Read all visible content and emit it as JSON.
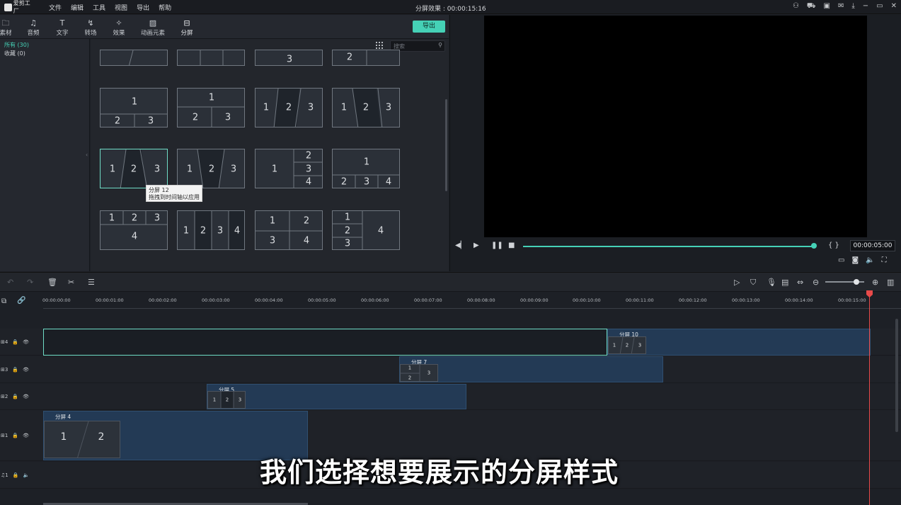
{
  "app": {
    "logo_text": "爱剪工厂",
    "menu": [
      "文件",
      "编辑",
      "工具",
      "视图",
      "导出",
      "帮助"
    ],
    "window_title": "分屏效果 : 00:00:15:16"
  },
  "tool_tabs": [
    {
      "label": "素材",
      "icon": "folder-icon"
    },
    {
      "label": "音频",
      "icon": "music-note-icon"
    },
    {
      "label": "文字",
      "icon": "text-icon"
    },
    {
      "label": "转场",
      "icon": "transition-icon"
    },
    {
      "label": "效果",
      "icon": "effects-icon"
    },
    {
      "label": "动画元素",
      "icon": "image-icon"
    },
    {
      "label": "分屏",
      "icon": "split-screen-icon"
    }
  ],
  "export_label": "导出",
  "categories": {
    "all": "所有 (30)",
    "favorites": "收藏 (0)"
  },
  "search": {
    "placeholder": "搜索"
  },
  "tiles": {
    "top_partial_numbers": [
      "3",
      "2"
    ],
    "row1": [
      [
        "1",
        "2",
        "3"
      ],
      [
        "1",
        "2",
        "3"
      ],
      [
        "1",
        "2",
        "3"
      ],
      [
        "1",
        "2",
        "3"
      ]
    ],
    "row2": [
      [
        "1",
        "2",
        "3"
      ],
      [
        "1",
        "2",
        "3"
      ],
      [
        "1",
        "2",
        "3",
        "4"
      ],
      [
        "1",
        "2",
        "3",
        "4"
      ]
    ],
    "row3": [
      [
        "1",
        "2",
        "3",
        "4"
      ],
      [
        "1",
        "2",
        "3",
        "4"
      ],
      [
        "1",
        "2",
        "3",
        "4"
      ],
      [
        "1",
        "2",
        "3",
        "4"
      ]
    ]
  },
  "tooltip": {
    "title": "分屏 12",
    "hint": "拖拽到时间轴以应用"
  },
  "preview": {
    "timecode": "00:00:05:00",
    "brackets": "{ }",
    "progress": 0.93
  },
  "ruler_ticks": [
    "00:00:00:00",
    "00:00:01:00",
    "00:00:02:00",
    "00:00:03:00",
    "00:00:04:00",
    "00:00:05:00",
    "00:00:06:00",
    "00:00:07:00",
    "00:00:08:00",
    "00:00:09:00",
    "00:00:10:00",
    "00:00:11:00",
    "00:00:12:00",
    "00:00:13:00",
    "00:00:14:00",
    "00:00:15:00"
  ],
  "tracks": [
    {
      "id": "4",
      "clip_name": "分屏 10",
      "thumb_numbers": [
        "1",
        "2",
        "3"
      ]
    },
    {
      "id": "3",
      "clip_name": "分屏 7",
      "thumb_numbers": [
        "1",
        "3",
        "2"
      ]
    },
    {
      "id": "2",
      "clip_name": "分屏 5",
      "thumb_numbers": [
        "1",
        "2",
        "3"
      ]
    },
    {
      "id": "1",
      "clip_name": "分屏 4",
      "thumb_numbers": [
        "1",
        "2"
      ]
    },
    {
      "id": "1",
      "type": "audio"
    }
  ],
  "subtitle": "我们选择想要展示的分屏样式",
  "colors": {
    "accent": "#45d1b6",
    "clip": "#233a55",
    "playhead": "#e84a4a"
  }
}
